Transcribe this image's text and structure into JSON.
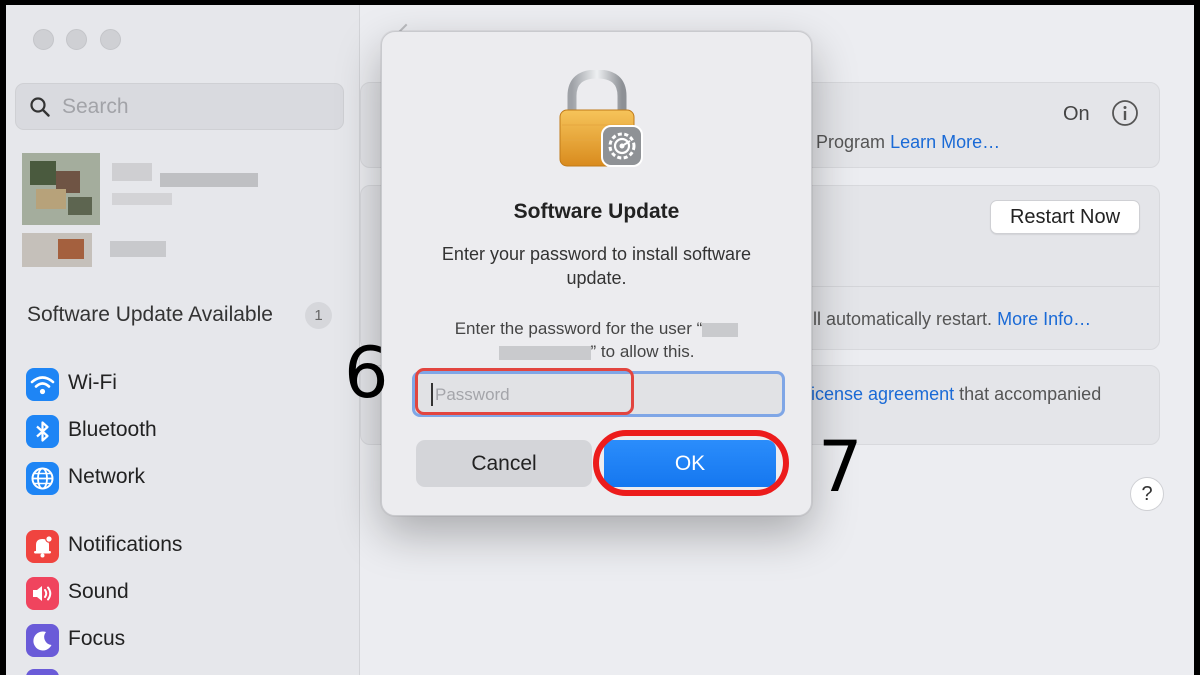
{
  "sidebar": {
    "search_placeholder": "Search",
    "update_label": "Software Update Available",
    "update_badge": "1",
    "items": [
      {
        "label": "Wi-Fi",
        "icon": "wifi-icon",
        "color": "#1e85f5"
      },
      {
        "label": "Bluetooth",
        "icon": "bluetooth-icon",
        "color": "#1e85f5"
      },
      {
        "label": "Network",
        "icon": "network-globe-icon",
        "color": "#1e85f5"
      },
      {
        "label": "Notifications",
        "icon": "notifications-bell-icon",
        "color": "#f0443f"
      },
      {
        "label": "Sound",
        "icon": "sound-speaker-icon",
        "color": "#f0445e"
      },
      {
        "label": "Focus",
        "icon": "focus-moon-icon",
        "color": "#6a5bd8"
      }
    ]
  },
  "main": {
    "beta_status": "On",
    "beta_text": "e Program",
    "beta_link": "Learn More…",
    "restart_button": "Restart Now",
    "restart_text": "ill automatically restart.",
    "restart_link": "More Info…",
    "license_link": "icense agreement",
    "license_text": "that accompanied",
    "help": "?"
  },
  "dialog": {
    "title": "Software Update",
    "message": "Enter your password to install software update.",
    "prompt_start": "Enter the password for the user “",
    "prompt_end": "” to allow this.",
    "password_placeholder": "Password",
    "cancel": "Cancel",
    "ok": "OK"
  },
  "annotations": {
    "step_password": "6",
    "step_ok": "7",
    "highlight_color": "#ec1c1c"
  },
  "colors": {
    "accent": "#1a7ef5",
    "link": "#1a6ad6"
  }
}
